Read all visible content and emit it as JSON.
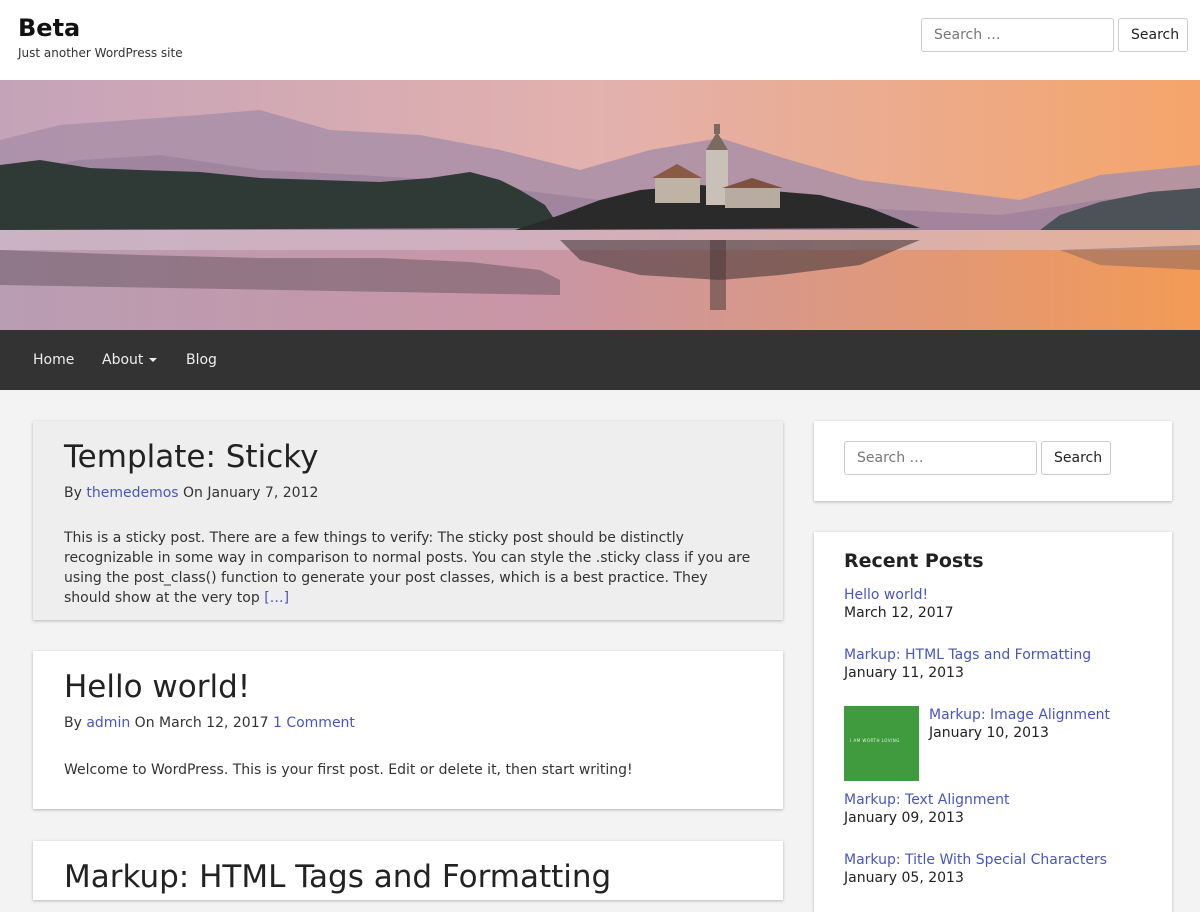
{
  "site": {
    "title": "Beta",
    "tagline": "Just another WordPress site"
  },
  "header_search": {
    "placeholder": "Search …",
    "button_label": "Search"
  },
  "nav": {
    "items": [
      {
        "label": "Home"
      },
      {
        "label": "About",
        "has_dropdown": true
      },
      {
        "label": "Blog"
      }
    ]
  },
  "posts": [
    {
      "title": "Template: Sticky",
      "by": "By",
      "author": "themedemos",
      "on": "On",
      "date": "January 7, 2012",
      "excerpt": "This is a sticky post. There are a few things to verify: The sticky post should be distinctly recognizable in some way in comparison to normal posts. You can style the .sticky class if you are using the post_class() function to generate your post classes, which is a best practice. They should show at the very top",
      "more_link": "[…]",
      "sticky": true
    },
    {
      "title": "Hello world!",
      "by": "By",
      "author": "admin",
      "on": "On",
      "date": "March 12, 2017",
      "comments": "1 Comment",
      "excerpt": "Welcome to WordPress. This is your first post. Edit or delete it, then start writing!"
    },
    {
      "title": "Markup: HTML Tags and Formatting"
    }
  ],
  "sidebar": {
    "search": {
      "placeholder": "Search …",
      "button_label": "Search"
    },
    "recent_posts": {
      "title": "Recent Posts",
      "items": [
        {
          "title": "Hello world!",
          "date": "March 12, 2017"
        },
        {
          "title": "Markup: HTML Tags and Formatting",
          "date": "January 11, 2013"
        },
        {
          "title": "Markup: Image Alignment",
          "date": "January 10, 2013",
          "thumbnail_text": "I AM WORTH LOVING"
        },
        {
          "title": "Markup: Text Alignment",
          "date": "January 09, 2013"
        },
        {
          "title": "Markup: Title With Special Characters",
          "date": "January 05, 2013"
        }
      ]
    }
  },
  "colors": {
    "link": "#4a55c4",
    "nav_background": "#333333",
    "page_background": "#f3f3f3",
    "sticky_background": "#eeeeee",
    "thumbnail_green": "#3f9b3d"
  }
}
